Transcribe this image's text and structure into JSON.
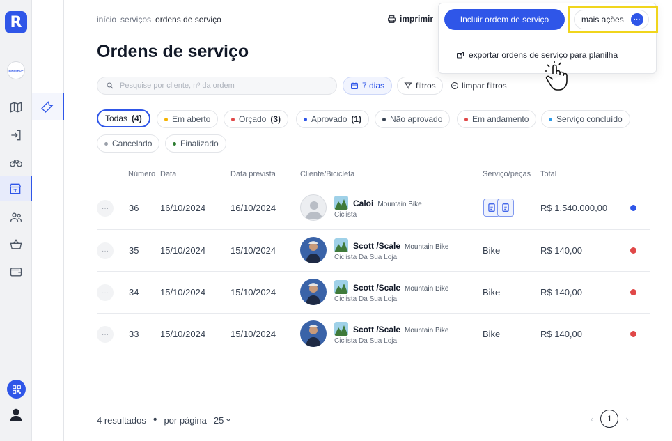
{
  "app": {
    "logo_letter": "R",
    "store_badge": "BIKESHOP"
  },
  "breadcrumb": [
    "início",
    "serviços",
    "ordens de serviço"
  ],
  "header": {
    "print_label": "imprimir",
    "title": "Ordens de serviço",
    "primary_action": "Incluir ordem de serviço",
    "more_actions": "mais ações",
    "more_dots": "···",
    "export_label": "exportar ordens de serviço para planilha"
  },
  "filters": {
    "search_placeholder": "Pesquise por cliente, nº da ordem",
    "days_label": "7 dias",
    "filters_label": "filtros",
    "clear_label": "limpar filtros"
  },
  "tabs": [
    {
      "label": "Todas",
      "count": "(4)",
      "dot": "",
      "active": true
    },
    {
      "label": "Em aberto",
      "count": "",
      "dot": "#f5b301"
    },
    {
      "label": "Orçado",
      "count": "(3)",
      "dot": "#e04848"
    },
    {
      "label": "Aprovado",
      "count": "(1)",
      "dot": "#2f56e8"
    },
    {
      "label": "Não aprovado",
      "count": "",
      "dot": "#374151"
    },
    {
      "label": "Em andamento",
      "count": "",
      "dot": "#e04848"
    },
    {
      "label": "Serviço concluído",
      "count": "",
      "dot": "#2f9be8"
    },
    {
      "label": "Cancelado",
      "count": "",
      "dot": "#9aa0aa"
    },
    {
      "label": "Finalizado",
      "count": "",
      "dot": "#2e7d32"
    }
  ],
  "table": {
    "headers": [
      "Número",
      "Data",
      "Data prevista",
      "Cliente/Bicicleta",
      "Serviço/peças",
      "Total"
    ],
    "more_label": "···",
    "rows": [
      {
        "number": "36",
        "date": "16/10/2024",
        "due": "16/10/2024",
        "bike": "Caloi",
        "bike_type": "Mountain Bike",
        "customer": "Ciclista",
        "service": "",
        "total": "R$ 1.540.000,00",
        "status_color": "#2f56e8",
        "avatar": "placeholder"
      },
      {
        "number": "35",
        "date": "15/10/2024",
        "due": "15/10/2024",
        "bike": "Scott /Scale",
        "bike_type": "Mountain Bike",
        "customer": "Ciclista Da Sua Loja",
        "service": "Bike",
        "total": "R$ 140,00",
        "status_color": "#e04848",
        "avatar": "photo"
      },
      {
        "number": "34",
        "date": "15/10/2024",
        "due": "15/10/2024",
        "bike": "Scott /Scale",
        "bike_type": "Mountain Bike",
        "customer": "Ciclista Da Sua Loja",
        "service": "Bike",
        "total": "R$ 140,00",
        "status_color": "#e04848",
        "avatar": "photo"
      },
      {
        "number": "33",
        "date": "15/10/2024",
        "due": "15/10/2024",
        "bike": "Scott /Scale",
        "bike_type": "Mountain Bike",
        "customer": "Ciclista Da Sua Loja",
        "service": "Bike",
        "total": "R$ 140,00",
        "status_color": "#e04848",
        "avatar": "photo"
      }
    ]
  },
  "footer": {
    "results": "4 resultados",
    "bullet": "•",
    "per_page_label": "por página",
    "per_page_value": "25",
    "prev": "‹",
    "page": "1",
    "next": "›"
  },
  "colors": {
    "accent": "#2f56e8",
    "highlight": "#f0d51c"
  }
}
